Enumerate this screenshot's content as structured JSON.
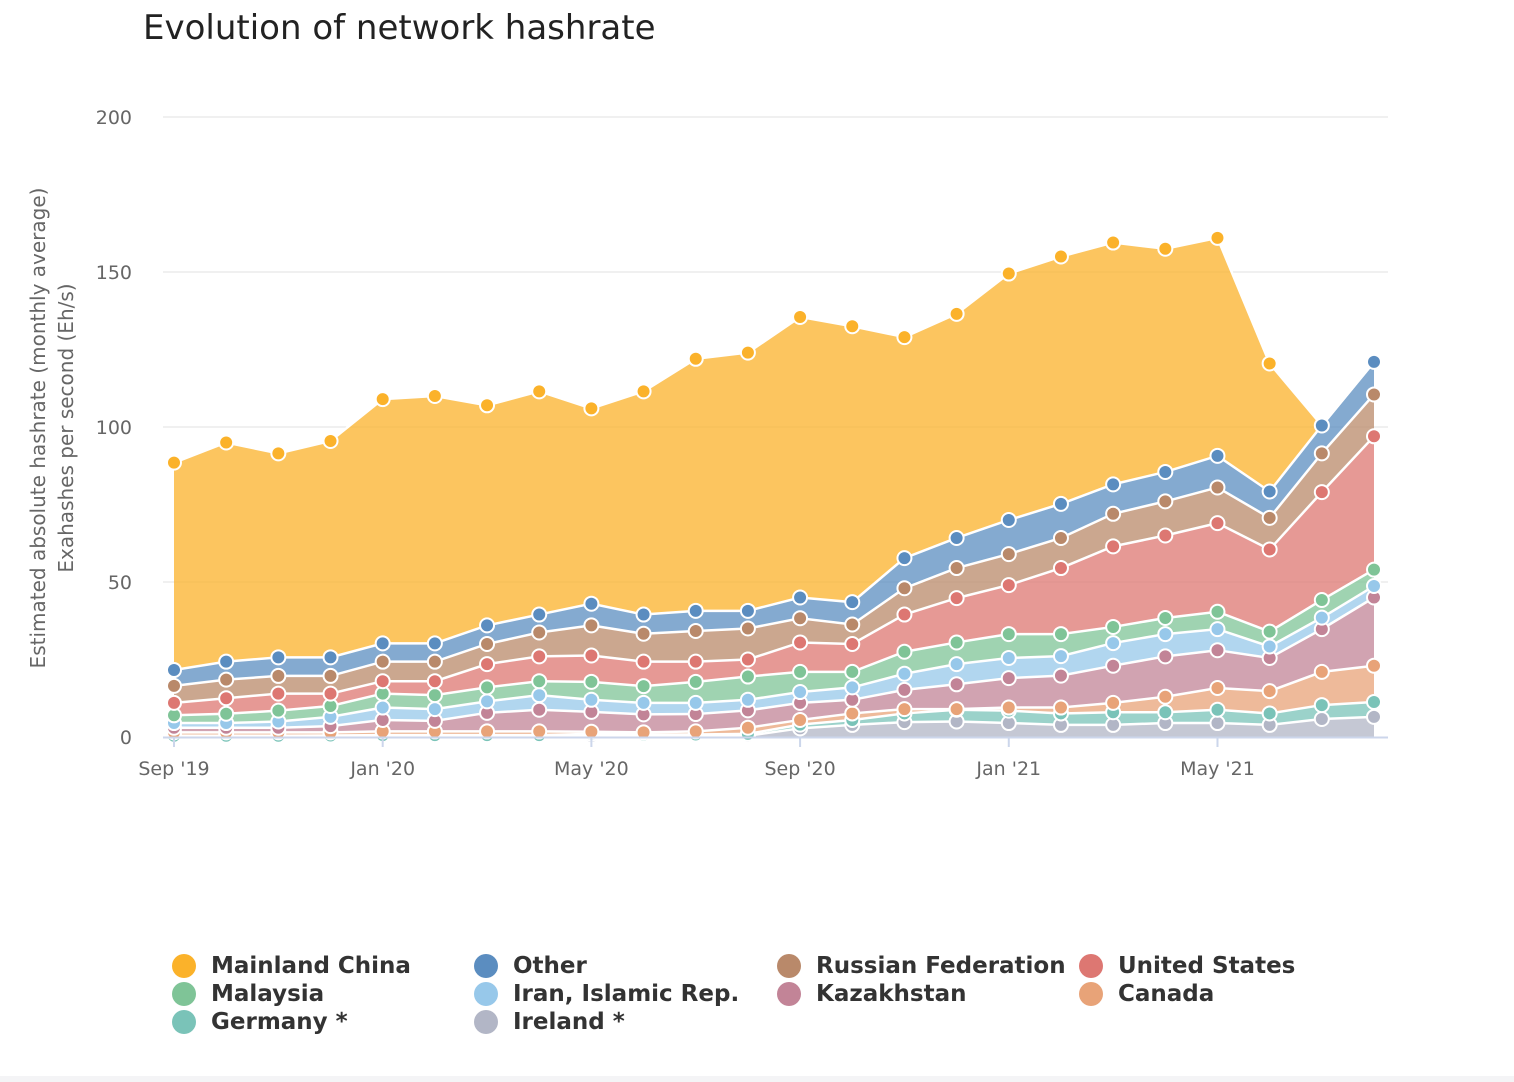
{
  "chart_data": {
    "type": "area",
    "stacked": true,
    "title": "Evolution of network hashrate",
    "ylabel": [
      "Estimated absolute hashrate (monthly average)",
      "Exahashes per second (Eh/s)"
    ],
    "xlabel": "",
    "ylim": [
      0,
      200
    ],
    "yticks": [
      0,
      50,
      100,
      150,
      200
    ],
    "grid": true,
    "legend_position": "bottom",
    "x": [
      "2019-09",
      "2019-10",
      "2019-11",
      "2019-12",
      "2020-01",
      "2020-02",
      "2020-03",
      "2020-04",
      "2020-05",
      "2020-06",
      "2020-07",
      "2020-08",
      "2020-09",
      "2020-10",
      "2020-11",
      "2020-12",
      "2021-01",
      "2021-02",
      "2021-03",
      "2021-04",
      "2021-05",
      "2021-06",
      "2021-07",
      "2021-08"
    ],
    "xtick_labels": [
      {
        "x": "2019-09",
        "label": "Sep '19"
      },
      {
        "x": "2020-01",
        "label": "Jan '20"
      },
      {
        "x": "2020-05",
        "label": "May '20"
      },
      {
        "x": "2020-09",
        "label": "Sep '20"
      },
      {
        "x": "2021-01",
        "label": "Jan '21"
      },
      {
        "x": "2021-05",
        "label": "May '21"
      }
    ],
    "series": [
      {
        "name": "Ireland *",
        "color": "#b2b6c6",
        "values": [
          0.2,
          0.2,
          0.2,
          0.2,
          0.3,
          0.3,
          0.3,
          0.3,
          0.3,
          0.3,
          0.3,
          0.4,
          2.8,
          3.9,
          4.8,
          5.0,
          4.5,
          3.9,
          3.9,
          4.5,
          4.5,
          3.9,
          5.8,
          6.5
        ]
      },
      {
        "name": "Germany *",
        "color": "#7ac3b8",
        "values": [
          0.2,
          0.2,
          0.2,
          0.3,
          0.3,
          0.3,
          0.3,
          0.3,
          0.7,
          0.5,
          0.5,
          0.6,
          1.2,
          1.6,
          2.8,
          3.8,
          4.0,
          3.7,
          4.1,
          3.5,
          4.3,
          3.7,
          4.5,
          4.8
        ]
      },
      {
        "name": "Canada",
        "color": "#e8a378",
        "values": [
          1.1,
          1.1,
          1.1,
          1.0,
          1.2,
          1.2,
          1.2,
          1.2,
          0.7,
          0.7,
          1.0,
          2.0,
          1.5,
          2.1,
          1.4,
          0.2,
          1.0,
          1.9,
          3.0,
          5.0,
          7.0,
          7.2,
          10.7,
          11.7
        ]
      },
      {
        "name": "Kazakhstan",
        "color": "#c28497",
        "values": [
          1.5,
          1.5,
          1.5,
          2.0,
          3.7,
          3.4,
          6.0,
          7.0,
          6.4,
          5.8,
          5.6,
          5.6,
          5.5,
          4.4,
          6.2,
          8.0,
          9.5,
          10.3,
          12.0,
          13.0,
          12.2,
          10.7,
          13.8,
          22.0
        ]
      },
      {
        "name": "Iran, Islamic Rep.",
        "color": "#97c8ea",
        "values": [
          1.5,
          1.5,
          2.0,
          3.0,
          4.0,
          3.8,
          3.7,
          4.7,
          3.9,
          3.7,
          3.6,
          3.4,
          3.5,
          4.0,
          5.2,
          6.5,
          6.5,
          6.3,
          7.3,
          7.2,
          6.8,
          3.7,
          3.7,
          3.7
        ]
      },
      {
        "name": "Malaysia",
        "color": "#7fc497",
        "values": [
          2.5,
          3.0,
          3.5,
          3.5,
          4.5,
          4.5,
          4.5,
          4.5,
          5.8,
          5.4,
          6.8,
          7.5,
          6.5,
          5.0,
          7.1,
          7.0,
          7.7,
          7.1,
          5.2,
          5.2,
          5.6,
          4.8,
          5.7,
          5.3
        ]
      },
      {
        "name": "United States",
        "color": "#dd7772",
        "values": [
          4.0,
          5.0,
          5.5,
          4.0,
          4.0,
          4.5,
          7.5,
          8.0,
          8.5,
          7.9,
          6.5,
          5.5,
          9.5,
          9.0,
          12.0,
          14.3,
          15.8,
          21.3,
          26.0,
          26.6,
          28.6,
          26.5,
          34.8,
          43.0
        ]
      },
      {
        "name": "Russian Federation",
        "color": "#b9896a",
        "values": [
          5.5,
          6.0,
          5.7,
          5.7,
          6.3,
          6.3,
          6.5,
          7.7,
          9.7,
          9.0,
          9.9,
          10.0,
          7.8,
          6.3,
          8.5,
          9.7,
          10.0,
          9.7,
          10.5,
          11.0,
          11.5,
          10.2,
          12.5,
          13.5
        ]
      },
      {
        "name": "Other",
        "color": "#5b8dc0",
        "values": [
          5.1,
          5.8,
          6.0,
          6.0,
          5.9,
          5.9,
          6.0,
          5.8,
          7.0,
          6.2,
          6.5,
          5.7,
          6.7,
          7.2,
          9.7,
          9.7,
          11.0,
          11.0,
          9.5,
          9.5,
          10.2,
          8.5,
          9.0,
          10.5
        ]
      },
      {
        "name": "Mainland China",
        "color": "#fbb22a",
        "values": [
          66.9,
          70.7,
          65.8,
          69.8,
          78.8,
          79.8,
          71.0,
          72.0,
          63.0,
          72.0,
          81.3,
          83.3,
          90.5,
          89.0,
          71.3,
          72.3,
          79.5,
          79.8,
          78.0,
          72.0,
          70.3,
          41.3,
          0,
          0
        ]
      }
    ],
    "legend": [
      "Mainland China",
      "Other",
      "Russian Federation",
      "United States",
      "Malaysia",
      "Iran, Islamic Rep.",
      "Kazakhstan",
      "Canada",
      "Germany *",
      "Ireland *"
    ]
  }
}
